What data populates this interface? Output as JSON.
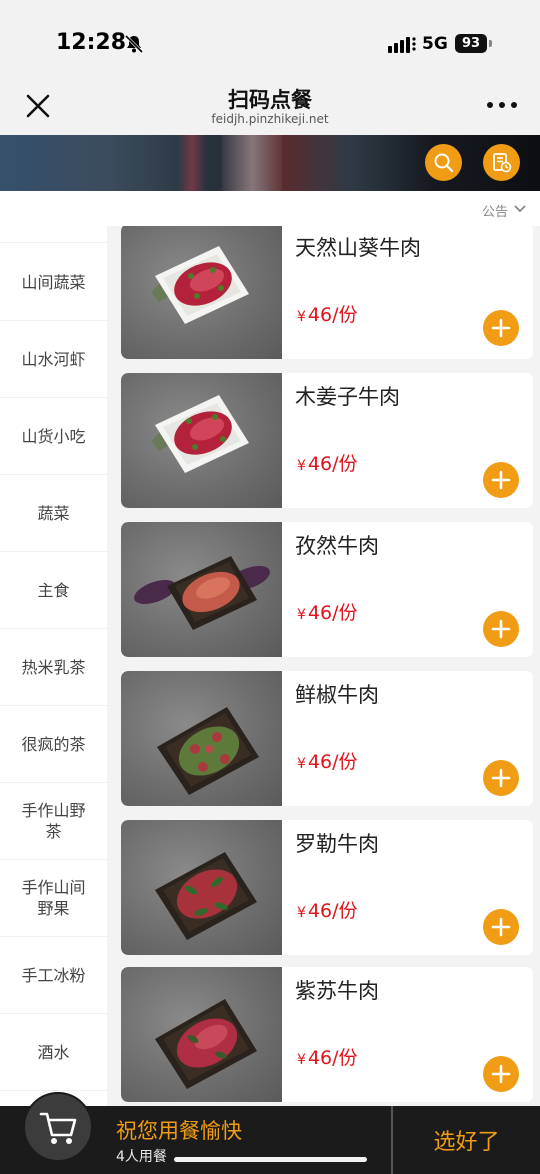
{
  "status": {
    "time": "12:28",
    "network": "5G",
    "battery": "93"
  },
  "nav": {
    "title": "扫码点餐",
    "url": "feidjh.pinzhikeji.net"
  },
  "notice": {
    "label": "公告"
  },
  "categories": [
    "山间蔬菜",
    "山水河虾",
    "山货小吃",
    "蔬菜",
    "主食",
    "热米乳茶",
    "很疯的茶",
    "手作山野茶",
    "手作山间野果",
    "手工冰粉",
    "酒水"
  ],
  "products": [
    {
      "name": "天然山葵牛肉",
      "currency": "¥",
      "price": "46/份"
    },
    {
      "name": "木姜子牛肉",
      "currency": "¥",
      "price": "46/份"
    },
    {
      "name": "孜然牛肉",
      "currency": "¥",
      "price": "46/份"
    },
    {
      "name": "鲜椒牛肉",
      "currency": "¥",
      "price": "46/份"
    },
    {
      "name": "罗勒牛肉",
      "currency": "¥",
      "price": "46/份"
    },
    {
      "name": "紫苏牛肉",
      "currency": "¥",
      "price": "46/份"
    }
  ],
  "bottom": {
    "greeting": "祝您用餐愉快",
    "diners": "4人用餐",
    "done": "选好了"
  },
  "colors": {
    "accent": "#f09c14",
    "price": "#e0141e",
    "bottom_bar": "#1b1b1b"
  }
}
